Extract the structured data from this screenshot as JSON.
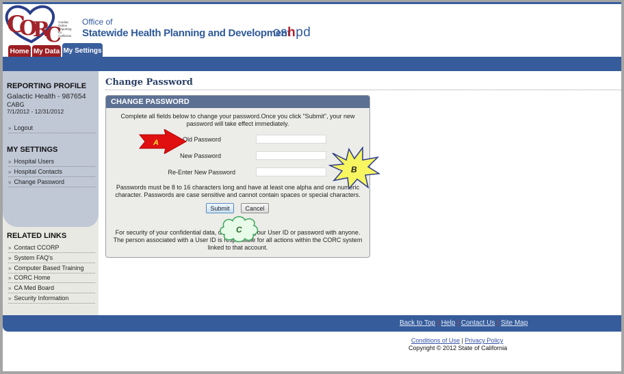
{
  "header": {
    "logo_text": "CORC",
    "logo_subtext": [
      "Cardiac",
      "Online",
      "Reporting",
      "for",
      "California"
    ],
    "office_line": "Office of",
    "org_name": "Statewide Health Planning and Development",
    "oshpd_logo": {
      "left": "os",
      "mid": "h",
      "right": "pd"
    }
  },
  "tabs": [
    {
      "label": "Home",
      "active": false
    },
    {
      "label": "My Data",
      "active": false
    },
    {
      "label": "My Settings",
      "active": true
    }
  ],
  "sidebar": {
    "profile_heading": "REPORTING PROFILE",
    "facility": "Galactic Health   -  987654",
    "program": "CABG",
    "period": "7/1/2012 - 12/31/2012",
    "logout_label": "Logout",
    "settings_heading": "MY SETTINGS",
    "settings_links": [
      "Hospital Users",
      "Hospital Contacts",
      "Change Password"
    ],
    "related_heading": "RELATED LINKS",
    "related_links": [
      "Contact CCORP",
      "System FAQ's",
      "Computer Based Training",
      "CORC Home",
      "CA Med Board",
      "Security Information"
    ]
  },
  "main": {
    "page_title": "Change Password",
    "panel_title": "CHANGE PASSWORD",
    "intro_line1": "Complete all fields below to change your password.Once you click \"Submit\", your new",
    "intro_line2": "password will take effect immediately.",
    "fields": [
      {
        "label": "Old Password",
        "value": ""
      },
      {
        "label": "New Password",
        "value": ""
      },
      {
        "label": "Re-Enter New Password",
        "value": ""
      }
    ],
    "rules_line1": "Passwords must be 8 to 16 characters long and have at least one alpha and one numeric",
    "rules_line2": "character. Passwords are case sensitive and cannot contain spaces or special characters.",
    "submit_label": "Submit",
    "cancel_label": "Cancel",
    "security_line1": "For security of your confidential data, do not share your User ID or password with anyone.",
    "security_line2": "The person associated with a User ID is responsible for all actions within the CORC system",
    "security_line3": "linked to that account."
  },
  "annotations": {
    "a": "A",
    "b": "B",
    "c": "C",
    "colors": {
      "a_fill": "#e01010",
      "a_text": "#ffe23a",
      "b_fill": "#f7f560",
      "b_stroke": "#2a3a8a",
      "c_fill": "#e8fbe8",
      "c_stroke": "#3aa65a",
      "c_text": "#2a6a2a"
    }
  },
  "footer": {
    "links": [
      "Back to Top",
      "Help",
      "Contact Us",
      "Site Map"
    ],
    "legal_links": [
      "Conditions of Use",
      "Privacy Policy"
    ],
    "legal_sep": "|",
    "copyright": "Copyright © 2012 State of California"
  }
}
